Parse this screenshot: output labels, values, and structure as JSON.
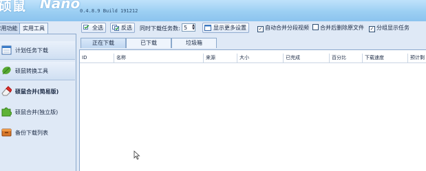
{
  "header": {
    "logo_cn": "硕鼠",
    "logo_en": "Nano",
    "version": "0.4.8.9 Build 191212"
  },
  "left_tabs": [
    "常用功能",
    "实用工具"
  ],
  "left_panel": {
    "items": [
      {
        "label": "计划任务下载",
        "icon": "calendar-icon"
      },
      {
        "label": "硕鼠转换工具",
        "icon": "leaf-icon"
      },
      {
        "label": "硕鼠合并(简易版)",
        "icon": "eraser-icon"
      },
      {
        "label": "硕鼠合并(独立版)",
        "icon": "puzzle-icon"
      },
      {
        "label": "备份下载列表",
        "icon": "box-icon"
      }
    ]
  },
  "toolbar": {
    "select_all": "全选",
    "invert_select": "反选",
    "max_tasks_label": "同时下载任务数:",
    "max_tasks_value": "5",
    "more_settings": "显示更多设置",
    "auto_merge": {
      "label": "自动合并分段视频",
      "checked": true
    },
    "delete_after_merge": {
      "label": "合并后删除原文件",
      "checked": false
    },
    "group_display": {
      "label": "分组显示任务",
      "checked": true
    }
  },
  "content_tabs": [
    "正在下载",
    "已下载",
    "垃圾箱"
  ],
  "table": {
    "columns": [
      "ID",
      "名称",
      "来源",
      "大小",
      "已完成",
      "百分比",
      "下载速度",
      "预计剩"
    ]
  },
  "colors": {
    "header_top": "#bfe2fb",
    "header_bottom": "#8bc3ee",
    "panel_bg": "#dfe9f6",
    "border": "#8aa8cc"
  }
}
